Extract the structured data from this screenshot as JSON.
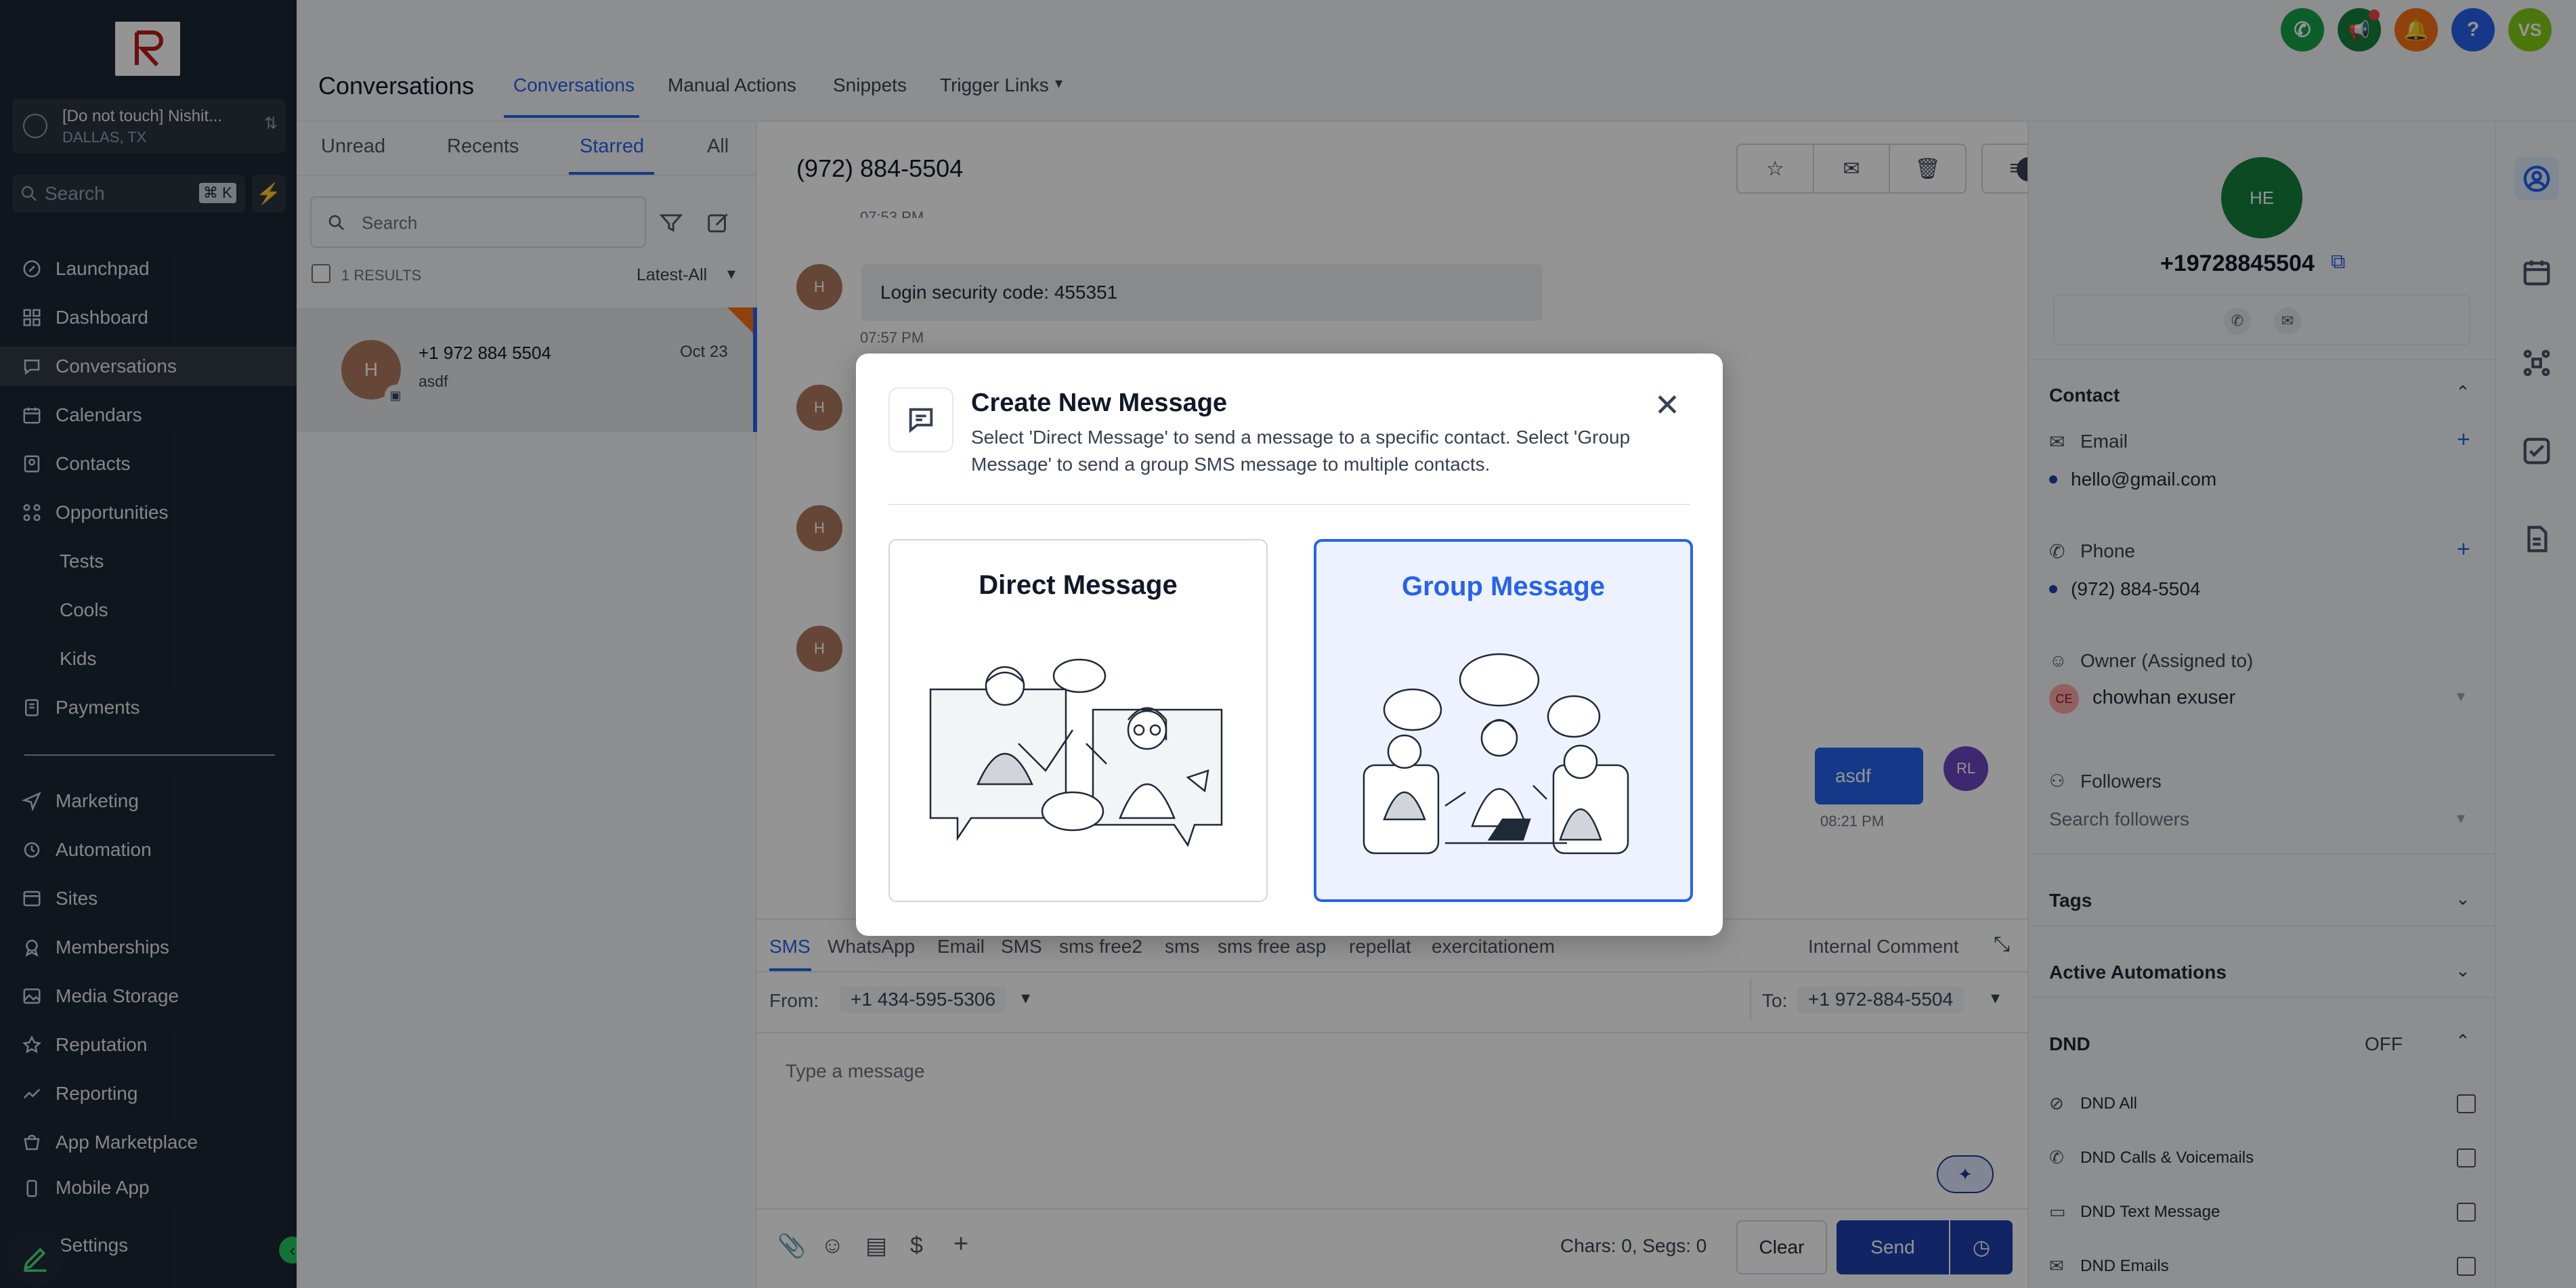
{
  "sidebar": {
    "account_name": "[Do not touch] Nishit...",
    "account_location": "DALLAS, TX",
    "search_placeholder": "Search",
    "search_shortcut": "⌘ K",
    "items": [
      {
        "label": "Launchpad",
        "icon": "rocket-icon"
      },
      {
        "label": "Dashboard",
        "icon": "grid-icon"
      },
      {
        "label": "Conversations",
        "icon": "chat-icon",
        "active": true
      },
      {
        "label": "Calendars",
        "icon": "calendar-icon"
      },
      {
        "label": "Contacts",
        "icon": "contacts-icon"
      },
      {
        "label": "Opportunities",
        "icon": "pipeline-icon"
      },
      {
        "label": "Tests",
        "sub": true
      },
      {
        "label": "Cools",
        "sub": true
      },
      {
        "label": "Kids",
        "sub": true
      },
      {
        "label": "Payments",
        "icon": "payments-icon"
      },
      {
        "label": "Marketing",
        "icon": "send-icon"
      },
      {
        "label": "Automation",
        "icon": "automation-icon"
      },
      {
        "label": "Sites",
        "icon": "sites-icon"
      },
      {
        "label": "Memberships",
        "icon": "membership-icon"
      },
      {
        "label": "Media Storage",
        "icon": "media-icon"
      },
      {
        "label": "Reputation",
        "icon": "reputation-icon"
      },
      {
        "label": "Reporting",
        "icon": "chart-icon"
      },
      {
        "label": "App Marketplace",
        "icon": "marketplace-icon"
      },
      {
        "label": "Mobile App",
        "icon": "mobile-icon"
      },
      {
        "label": "Settings",
        "icon": "settings-icon"
      }
    ]
  },
  "header": {
    "title": "Conversations",
    "tabs": [
      "Conversations",
      "Manual Actions",
      "Snippets",
      "Trigger Links"
    ],
    "user_initials": "VS"
  },
  "list": {
    "tabs": [
      "Unread",
      "Recents",
      "Starred",
      "All"
    ],
    "search_placeholder": "Search",
    "results": "1 RESULTS",
    "sort": "Latest-All",
    "item": {
      "avatar": "H",
      "name": "+1 972 884 5504",
      "date": "Oct 23",
      "preview": "asdf"
    }
  },
  "chat": {
    "title": "(972) 884-5504",
    "messages": [
      {
        "text": "Login security code: 455351",
        "time": "07:57 PM"
      },
      {
        "text": "asdf",
        "time": "08:21 PM",
        "avatar": "RL"
      }
    ],
    "partial_time": "07:53 PM",
    "avatar": "H",
    "composer": {
      "tabs": [
        "SMS",
        "WhatsApp",
        "Email",
        "SMS",
        "sms free2",
        "sms",
        "sms free asp",
        "repellat",
        "exercitationem"
      ],
      "internal_comment": "Internal Comment",
      "from_label": "From:",
      "from_value": "+1 434-595-5306",
      "to_label": "To:",
      "to_value": "+1 972-884-5504",
      "placeholder": "Type a message",
      "counter": "Chars: 0, Segs: 0",
      "clear": "Clear",
      "send": "Send"
    }
  },
  "contact": {
    "initials": "HE",
    "phone_header": "+19728845504",
    "section_contact": "Contact",
    "email_label": "Email",
    "email_value": "hello@gmail.com",
    "phone_label": "Phone",
    "phone_value": "(972) 884-5504",
    "owner_label": "Owner (Assigned to)",
    "owner_initials": "CE",
    "owner_name": "chowhan exuser",
    "followers_label": "Followers",
    "followers_placeholder": "Search followers",
    "tags": "Tags",
    "active_automations": "Active Automations",
    "dnd": "DND",
    "dnd_status": "OFF",
    "dnd_items": [
      "DND All",
      "DND Calls & Voicemails",
      "DND Text Message",
      "DND Emails"
    ]
  },
  "modal": {
    "title": "Create New Message",
    "description": "Select 'Direct Message' to send a message to a specific contact. Select 'Group Message' to send a group SMS message to multiple contacts.",
    "option_direct": "Direct Message",
    "option_group": "Group Message"
  },
  "colors": {
    "sidebar_bg": "#1d2733",
    "accent": "#2563eb",
    "send_button": "#1e40af"
  }
}
